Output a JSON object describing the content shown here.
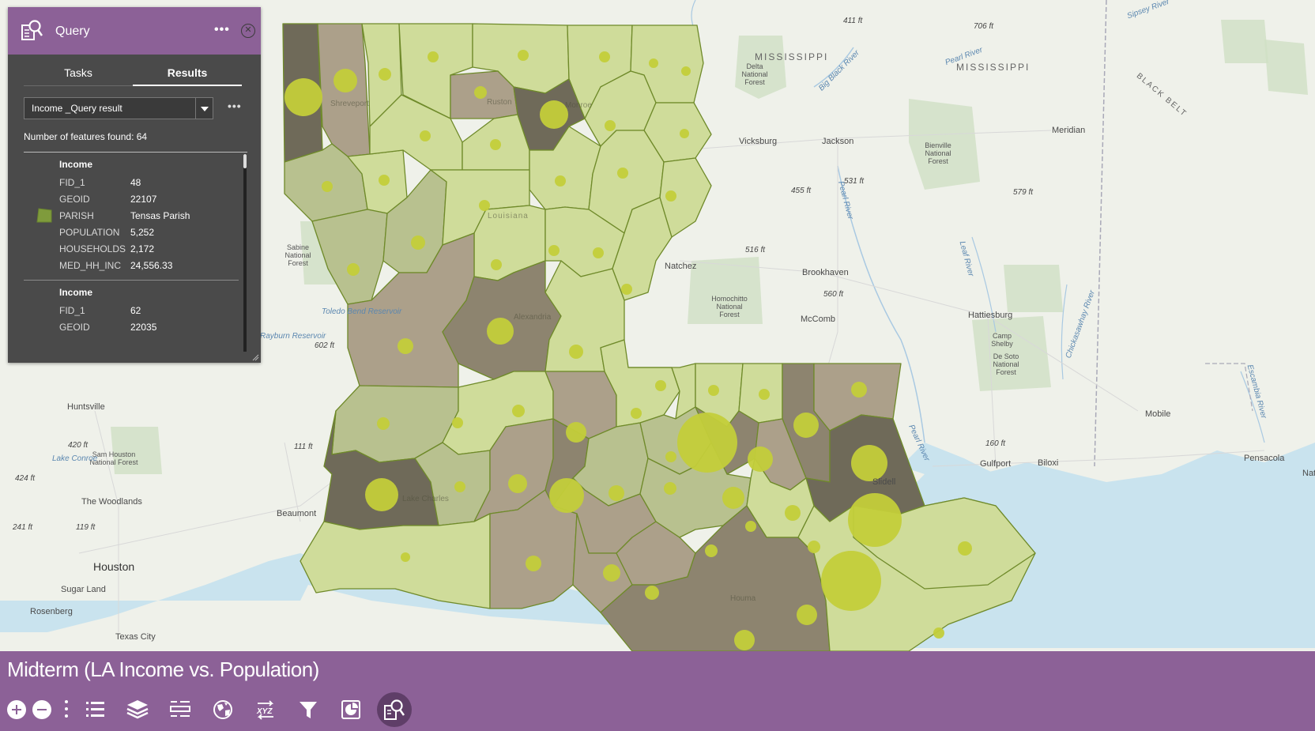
{
  "query_panel": {
    "title": "Query",
    "tabs": [
      {
        "label": "Tasks",
        "active": false
      },
      {
        "label": "Results",
        "active": true
      }
    ],
    "result_select_value": "Income _Query result",
    "feature_count": "Number of features found: 64",
    "results": [
      {
        "layer": "Income",
        "attributes": [
          {
            "key": "FID_1",
            "value": "48"
          },
          {
            "key": "GEOID",
            "value": "22107"
          },
          {
            "key": "PARISH",
            "value": "Tensas Parish"
          },
          {
            "key": "POPULATION",
            "value": "5,252"
          },
          {
            "key": "HOUSEHOLDS",
            "value": "2,172"
          },
          {
            "key": "MED_HH_INC",
            "value": "24,556.33"
          }
        ]
      },
      {
        "layer": "Income",
        "attributes": [
          {
            "key": "FID_1",
            "value": "62"
          },
          {
            "key": "GEOID",
            "value": "22035"
          }
        ]
      }
    ],
    "accent": "#8c6197",
    "panel_bg": "#4a4a4a"
  },
  "map": {
    "labels": {
      "states": [
        "MISSISSIPPI",
        "MISSISSIPPI",
        "BLACK BELT"
      ],
      "cities": [
        "Vicksburg",
        "Jackson",
        "Meridian",
        "Natchez",
        "Brookhaven",
        "McComb",
        "Hattiesburg",
        "Mobile",
        "Pensacola",
        "Gulfport",
        "Biloxi",
        "Beaumont",
        "Huntsville",
        "The Woodlands",
        "Houston",
        "Sugar Land",
        "Rosenberg",
        "Texas City",
        "Shreveport",
        "Monroe",
        "Ruston",
        "Alexandria",
        "Lake Charles",
        "Houma",
        "Slidell",
        "Nat"
      ],
      "forests": [
        "Delta National Forest",
        "Bienville National Forest",
        "Homochitto National Forest",
        "De Soto National Forest",
        "Sabine National Forest",
        "Sam Houston National Forest",
        "Camp Shelby"
      ],
      "water": [
        "Big Black River",
        "Pearl River",
        "Pearl River",
        "Leaf River",
        "Chickasawhay River",
        "Escambia River",
        "Sipsey River",
        "Pearl River",
        "Lake Conroe",
        "Toledo Bend Reservoir",
        "Rayburn Reservoir"
      ],
      "elevations": [
        "411 ft",
        "706 ft",
        "531 ft",
        "455 ft",
        "579 ft",
        "516 ft",
        "560 ft",
        "602 ft",
        "111 ft",
        "420 ft",
        "424 ft",
        "241 ft",
        "119 ft",
        "160 ft"
      ],
      "parishes": [
        "Louisiana",
        "Lake Charles",
        "Houma"
      ]
    },
    "palette": {
      "light": "#cfdc9a",
      "mid": "#b8c18f",
      "tan": "#aca08a",
      "brown": "#8d846f",
      "dark": "#6f6a59",
      "circle": "#c3cd3a",
      "water": "#c8e3ef"
    }
  },
  "bottom_bar": {
    "title": "Midterm (LA Income vs. Population)",
    "tools": [
      "zoom-in",
      "zoom-out",
      "more",
      "legend",
      "layers",
      "attribute-table",
      "basemap-gallery",
      "coordinates",
      "filter",
      "chart",
      "query"
    ]
  }
}
